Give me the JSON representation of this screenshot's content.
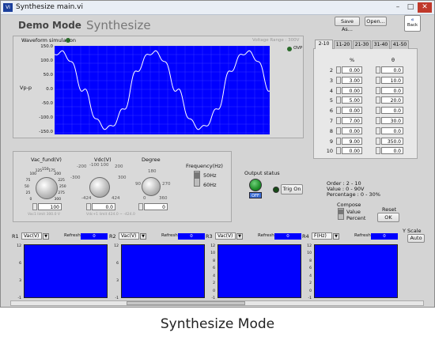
{
  "window": {
    "title": "Synthesize main.vi",
    "icon_label": "VI"
  },
  "header": {
    "demo_mode": "Demo Mode",
    "mode_title": "Synthesize"
  },
  "toolbar": {
    "save_as": "Save As...",
    "open": "Open...",
    "back": "Back"
  },
  "waveform": {
    "title": "Waveform simulation",
    "voltage_range": "Voltage Range :   300V",
    "ovp": "OVP",
    "ylabel": "Vp-p",
    "yticks": [
      "150.0",
      "100.0",
      "50.0",
      "0.0",
      "-50.0",
      "-100.0",
      "-150.0"
    ]
  },
  "controls": {
    "vac_label": "Vac_fund(V)",
    "vdc_label": "Vdc(V)",
    "degree_label": "Degree",
    "freq_label": "Frequency(Hz)",
    "freq_50": "50Hz",
    "freq_60": "60Hz",
    "vac_value": "100",
    "vdc_value": "0.0",
    "degree_value": "0",
    "vac_limit": "Vac1 limit  300.0  V",
    "vdc_limit": "Vdc+1 limit  424.0  ~ -424.0",
    "vac_scale": [
      "0",
      "25",
      "50",
      "75",
      "100",
      "125",
      "150",
      "175",
      "200",
      "225",
      "250",
      "275",
      "300"
    ],
    "vdc_scale": [
      "-424",
      "-300",
      "-200",
      "-100",
      "0",
      "100",
      "200",
      "300",
      "424"
    ],
    "deg_scale": [
      "0",
      "90",
      "180",
      "270",
      "360"
    ]
  },
  "output": {
    "label": "Output status",
    "off": "OFF",
    "trig": "Trig On"
  },
  "harmonics": {
    "tabs": [
      "2-10",
      "11-20",
      "21-30",
      "31-40",
      "41-50"
    ],
    "col_pct": "%",
    "col_theta": "θ",
    "orders": [
      "2",
      "3",
      "4",
      "5",
      "6",
      "7",
      "8",
      "9",
      "10"
    ],
    "pct": [
      "0.00",
      "3.00",
      "0.00",
      "5.00",
      "0.00",
      "7.00",
      "0.00",
      "9.00",
      "0.00"
    ],
    "theta": [
      "0.0",
      "10.0",
      "0.0",
      "20.0",
      "0.0",
      "30.0",
      "0.0",
      "350.0",
      "0.0"
    ],
    "info": [
      "Order        : 2 - 10",
      "Value        : 0 - 90V",
      "Percentage  : 0 - 30%"
    ],
    "compose": "Compose",
    "value": "Value",
    "percent": "Percent",
    "reset": "Reset",
    "ok": "OK"
  },
  "charts": {
    "yscale": "Y Scale",
    "auto": "Auto",
    "refresh": "Refresh",
    "items": [
      {
        "id": "R1",
        "sel": "Vac(V)",
        "refresh": "0",
        "yticks": [
          "12",
          "6",
          "3",
          "-1"
        ]
      },
      {
        "id": "R2",
        "sel": "Vac(V)",
        "refresh": "0",
        "yticks": [
          "12",
          "6",
          "3",
          "-1"
        ]
      },
      {
        "id": "R3",
        "sel": "Vac(V)",
        "refresh": "0",
        "yticks": [
          "12",
          "10",
          "8",
          "6",
          "4",
          "2",
          "0",
          "-1"
        ]
      },
      {
        "id": "R4",
        "sel": "F(Hz)",
        "refresh": "0",
        "yticks": [
          "12",
          "10",
          "8",
          "6",
          "4",
          "2",
          "0",
          "-1"
        ]
      }
    ]
  },
  "caption": "Synthesize Mode",
  "colors": {
    "graph": "#0000ff",
    "trace": "#ffffff",
    "led_green": "#1f8f2a"
  }
}
